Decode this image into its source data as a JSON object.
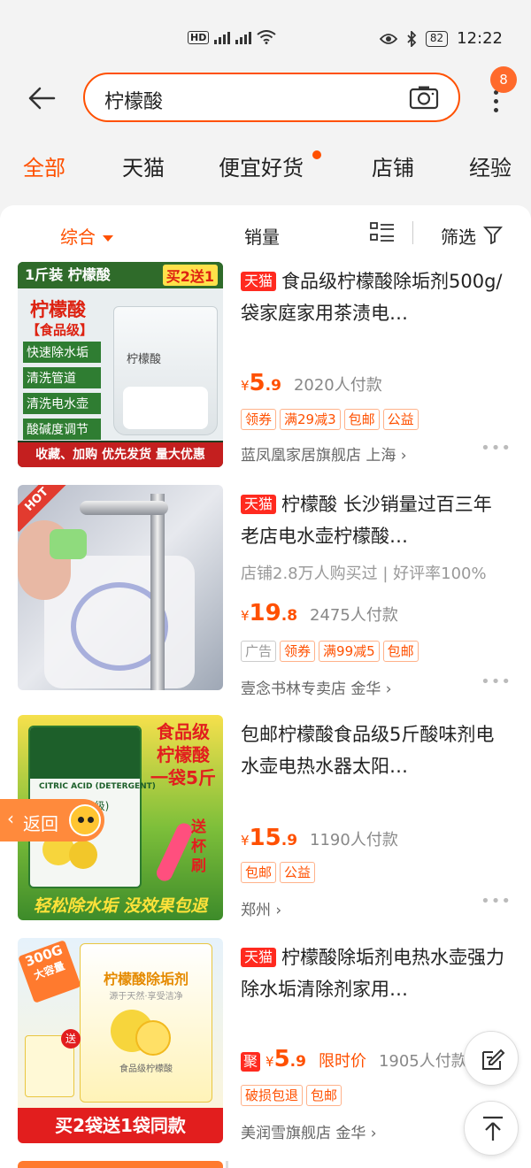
{
  "status": {
    "network": "HD 4G 5G",
    "battery": "82",
    "time": "12:22"
  },
  "search": {
    "query": "柠檬酸",
    "badge_count": "8"
  },
  "tabs": [
    {
      "label": "全部",
      "active": true
    },
    {
      "label": "天猫"
    },
    {
      "label": "便宜好货",
      "dot": true
    },
    {
      "label": "店铺"
    },
    {
      "label": "经验"
    }
  ],
  "sortbar": {
    "comprehensive": "综合",
    "sales": "销量",
    "filter": "筛选"
  },
  "products": [
    {
      "tmall": true,
      "title": "食品级柠檬酸除垢剂500g/袋家庭家用茶渍电…",
      "price_int": "5",
      "price_dec": ".9",
      "paid": "2020人付款",
      "tags": [
        "领券",
        "满29减3",
        "包邮",
        "公益"
      ],
      "shop": "蓝凤凰家居旗舰店 上海",
      "thumb": {
        "top": "1斤装 柠檬酸",
        "promo": "买2送1",
        "name": "柠檬酸",
        "grade": "【食品级】",
        "features": [
          "快速除水垢",
          "清洗管道",
          "清洗电水壶",
          "酸碱度调节"
        ],
        "bag": "柠檬酸",
        "bottom": "收藏、加购 优先发货 量大优惠"
      }
    },
    {
      "tmall": true,
      "title": "柠檬酸 长沙销量过百三年老店电水壶柠檬酸…",
      "subline": "店铺2.8万人购买过 | 好评率100%",
      "price_int": "19",
      "price_dec": ".8",
      "paid": "2475人付款",
      "ad": "广告",
      "tags": [
        "领券",
        "满99减5",
        "包邮"
      ],
      "shop": "壹念书林专卖店 金华",
      "thumb": {
        "hot": "HOT"
      }
    },
    {
      "tmall": false,
      "title": "包邮柠檬酸食品级5斤酸味剂电水壶电热水器太阳…",
      "price_int": "15",
      "price_dec": ".9",
      "paid": "1190人付款",
      "tags": [
        "包邮",
        "公益"
      ],
      "shop": "郑州",
      "thumb": {
        "side": "食品级 柠檬酸 一袋5斤",
        "brush": "送杯刷",
        "bag": "CITRIC ACID (DETERGENT)",
        "bag_name": "柠檬酸(食品级)",
        "bottom": "轻松除水垢 没效果包退"
      }
    },
    {
      "tmall": true,
      "title": "柠檬酸除垢剂电热水壶强力除水垢清除剂家用…",
      "ju": "聚",
      "price_int": "5",
      "price_dec": ".9",
      "limit": "限时价",
      "paid": "1905人付款",
      "tags": [
        "破损包退",
        "包邮"
      ],
      "shop": "美润雪旗舰店 金华",
      "thumb": {
        "badge": "300G",
        "badge2": "大容量",
        "name": "柠檬酸除垢剂",
        "sub": "源于天然·享受洁净",
        "grade": "食品级柠檬酸",
        "gift": "送",
        "bottom": "买2袋送1袋同款"
      }
    }
  ],
  "float": {
    "back": "返回"
  }
}
